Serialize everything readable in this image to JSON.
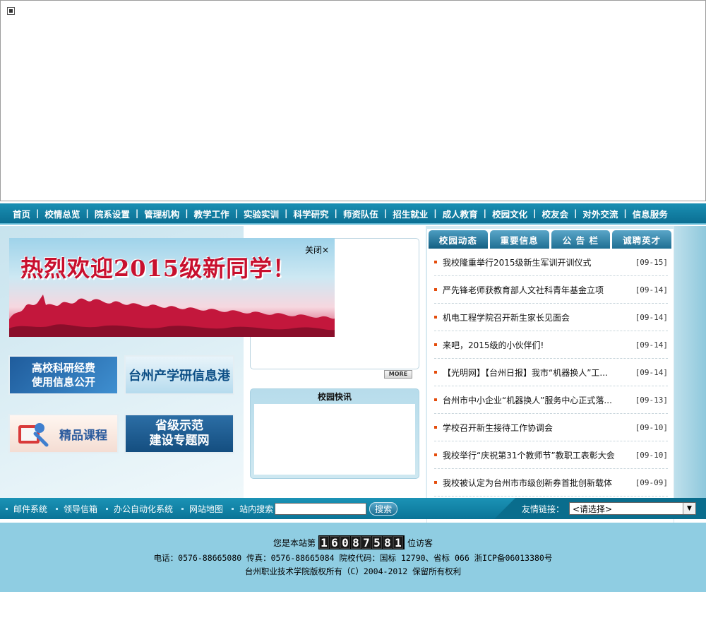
{
  "top_frame": {
    "broken_image_icon": "broken-image-icon"
  },
  "nav": {
    "items": [
      "首页",
      "校情总览",
      "院系设置",
      "管理机构",
      "教学工作",
      "实验实训",
      "科学研究",
      "师资队伍",
      "招生就业",
      "成人教育",
      "校园文化",
      "校友会",
      "对外交流",
      "信息服务"
    ]
  },
  "banner": {
    "headline": "热烈欢迎2015级新同学！",
    "close_label": "关闭×"
  },
  "promos": {
    "funds": [
      "高校科研经费",
      "使用信息公开"
    ],
    "info": "台州产学研信息港",
    "course": "精品课程",
    "demo": [
      "省级示范",
      "建设专题网"
    ]
  },
  "photo": {
    "more_label": "MORE"
  },
  "flash": {
    "title": "校园快讯"
  },
  "news": {
    "tabs": [
      "校园动态",
      "重要信息",
      "公 告 栏",
      "诚聘英才"
    ],
    "items": [
      {
        "title": "我校隆重举行2015级新生军训开训仪式",
        "date": "[09-15]"
      },
      {
        "title": "严先锋老师获教育部人文社科青年基金立项",
        "date": "[09-14]"
      },
      {
        "title": "机电工程学院召开新生家长见面会",
        "date": "[09-14]"
      },
      {
        "title": "来吧，2015级的小伙伴们!",
        "date": "[09-14]"
      },
      {
        "title": "【光明网】【台州日报】我市“机器换人”工...",
        "date": "[09-14]"
      },
      {
        "title": "台州市中小企业“机器换人”服务中心正式落...",
        "date": "[09-13]"
      },
      {
        "title": "学校召开新生接待工作协调会",
        "date": "[09-10]"
      },
      {
        "title": "我校举行“庆祝第31个教师节”教职工表彰大会",
        "date": "[09-10]"
      },
      {
        "title": "我校被认定为台州市市级创新券首批创新载体",
        "date": "[09-09]"
      }
    ]
  },
  "utility": {
    "links": [
      "邮件系统",
      "领导信箱",
      "办公自动化系统",
      "网站地图"
    ],
    "search_label": "站内搜索",
    "search_value": "",
    "search_button": "搜索",
    "friend_label": "友情链接：",
    "friend_selected": "<请选择>"
  },
  "footer": {
    "visitor_prefix": "您是本站第",
    "visitor_digits": [
      "1",
      "6",
      "0",
      "8",
      "7",
      "5",
      "8",
      "1"
    ],
    "visitor_suffix": "位访客",
    "contact": "电话：0576-88665080 传真：0576-88665084 院校代码：国标 12790、省标 066 浙ICP备06013380号",
    "copyright": "台州职业技术学院版权所有（C）2004-2012 保留所有权利"
  }
}
